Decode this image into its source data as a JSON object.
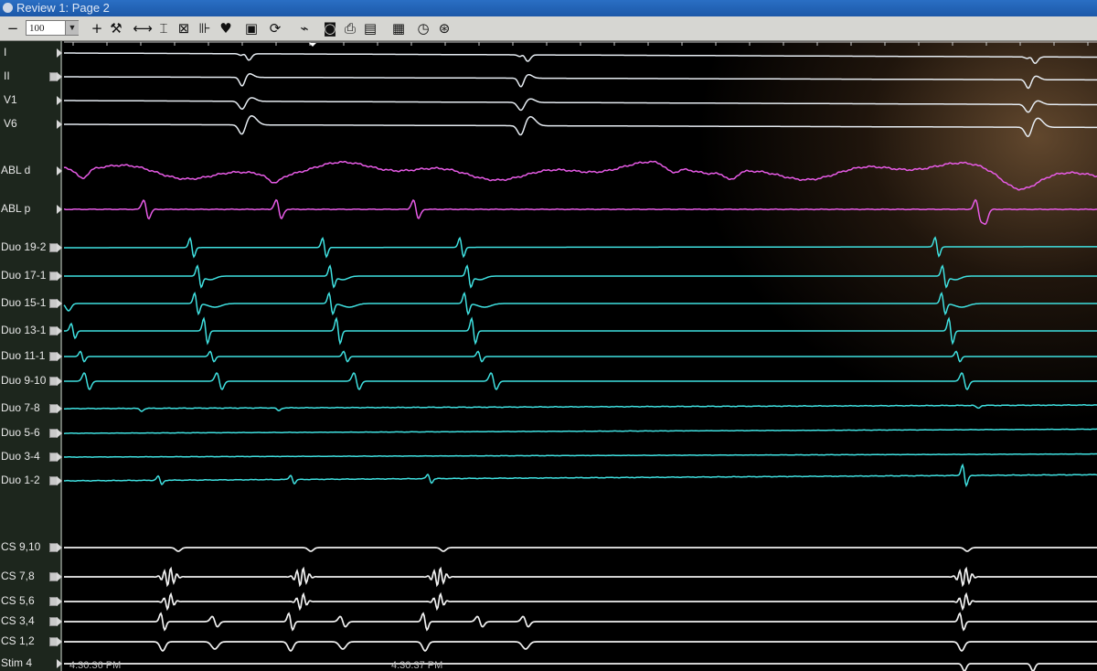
{
  "window": {
    "title": "Review 1: Page 2"
  },
  "toolbar": {
    "zoom_value": "100",
    "buttons": [
      {
        "name": "zoom-out-button",
        "glyph": "−"
      },
      {
        "name": "zoom-in-button",
        "glyph": "+"
      },
      {
        "name": "tools-icon",
        "glyph": "⚒"
      },
      {
        "name": "horizontal-caliper-icon",
        "glyph": "⟷"
      },
      {
        "name": "vertical-caliper-icon",
        "glyph": "⌶"
      },
      {
        "name": "marker-icon",
        "glyph": "⊠"
      },
      {
        "name": "interval-icon",
        "glyph": "⊪"
      },
      {
        "name": "heartbeat-icon",
        "glyph": "♥"
      },
      {
        "name": "monitor-icon",
        "glyph": "▣"
      },
      {
        "name": "sync-icon",
        "glyph": "⟳"
      },
      {
        "name": "signal-icon",
        "glyph": "⌁"
      },
      {
        "name": "camera-icon",
        "glyph": "◙"
      },
      {
        "name": "print-icon",
        "glyph": "⎙"
      },
      {
        "name": "printer-icon",
        "glyph": "▤"
      },
      {
        "name": "table-icon",
        "glyph": "▦"
      },
      {
        "name": "clock-icon",
        "glyph": "◷"
      },
      {
        "name": "settings-icon",
        "glyph": "⊛"
      }
    ]
  },
  "channels": [
    {
      "label": "I",
      "color": "#e6ecf2",
      "box": false
    },
    {
      "label": "II",
      "color": "#e6ecf2",
      "box": true
    },
    {
      "label": "V1",
      "color": "#e6ecf2",
      "box": false
    },
    {
      "label": "V6",
      "color": "#e6ecf2",
      "box": false
    },
    {
      "label": "ABL d",
      "color": "#e75be6",
      "box": false
    },
    {
      "label": "ABL p",
      "color": "#e75be6",
      "box": false
    },
    {
      "label": "Duo 19-2",
      "color": "#3fe0e0",
      "box": true
    },
    {
      "label": "Duo 17-1",
      "color": "#3fe0e0",
      "box": true
    },
    {
      "label": "Duo 15-1",
      "color": "#3fe0e0",
      "box": true
    },
    {
      "label": "Duo 13-1",
      "color": "#3fe0e0",
      "box": true
    },
    {
      "label": "Duo 11-1",
      "color": "#3fe0e0",
      "box": true
    },
    {
      "label": "Duo 9-10",
      "color": "#3fe0e0",
      "box": true
    },
    {
      "label": "Duo 7-8",
      "color": "#3fe0e0",
      "box": true
    },
    {
      "label": "Duo 5-6",
      "color": "#3fe0e0",
      "box": true
    },
    {
      "label": "Duo 3-4",
      "color": "#3fe0e0",
      "box": true
    },
    {
      "label": "Duo 1-2",
      "color": "#3fe0e0",
      "box": true
    },
    {
      "label": "CS 9,10",
      "color": "#f0f0f0",
      "box": true
    },
    {
      "label": "CS 7,8",
      "color": "#f0f0f0",
      "box": true
    },
    {
      "label": "CS 5,6",
      "color": "#f0f0f0",
      "box": true
    },
    {
      "label": "CS 3,4",
      "color": "#f0f0f0",
      "box": true
    },
    {
      "label": "CS 1,2",
      "color": "#f0f0f0",
      "box": true
    },
    {
      "label": "Stim 4",
      "color": "#f0f0f0",
      "box": false
    }
  ],
  "timestamps": [
    "4:30:36 PM",
    "4:30:37 PM"
  ]
}
